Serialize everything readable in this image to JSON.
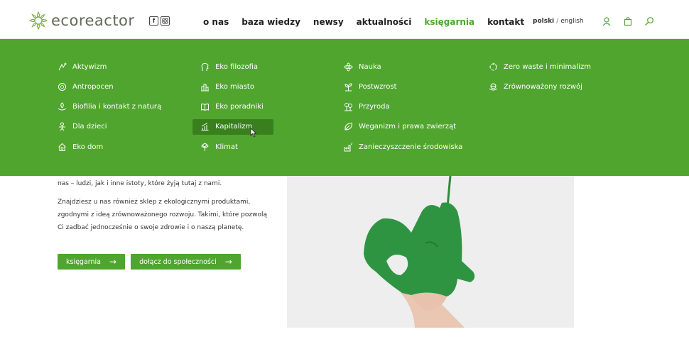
{
  "header": {
    "logo_text": "ecoreactor",
    "social": [
      "f",
      "ig"
    ],
    "nav": [
      {
        "label": "o nas",
        "active": false
      },
      {
        "label": "baza wiedzy",
        "active": false
      },
      {
        "label": "newsy",
        "active": false
      },
      {
        "label": "aktualności",
        "active": false
      },
      {
        "label": "księgarnia",
        "active": true
      },
      {
        "label": "kontakt",
        "active": false
      }
    ],
    "lang": {
      "current": "polski",
      "separator": "/",
      "other": "english"
    },
    "tools": [
      "user-icon",
      "bag-icon",
      "search-icon"
    ]
  },
  "mega_menu": {
    "columns": [
      [
        "Aktywizm",
        "Antropocen",
        "Biofilia i kontakt z naturą",
        "Dla dzieci",
        "Eko dom"
      ],
      [
        "Eko filozofia",
        "Eko miasto",
        "Eko poradniki",
        "Kapitalizm",
        "Klimat"
      ],
      [
        "Nauka",
        "Postwzrost",
        "Przyroda",
        "Weganizm i prawa zwierząt",
        "Zanieczyszczenie środowiska"
      ],
      [
        "Zero waste i minimalizm",
        "Zrównoważony rozwój"
      ]
    ],
    "hovered": "Kapitalizm"
  },
  "content": {
    "p1": "nas – ludzi, jak i inne istoty, które żyją tutaj z nami.",
    "p2": "Znajdziesz u nas również sklep z ekologicznymi produktami, zgodnymi z ideą zrównoważonego rozwoju. Takimi, które pozwolą Ci zadbać jednocześnie o swoje zdrowie i o naszą planetę.",
    "btn1": "księgarnia",
    "btn2": "dołącz do społeczności",
    "arrow": "→"
  },
  "colors": {
    "brand_green": "#50a52f",
    "hover_green": "#3a7f1d",
    "active_nav": "#4ca72f"
  }
}
